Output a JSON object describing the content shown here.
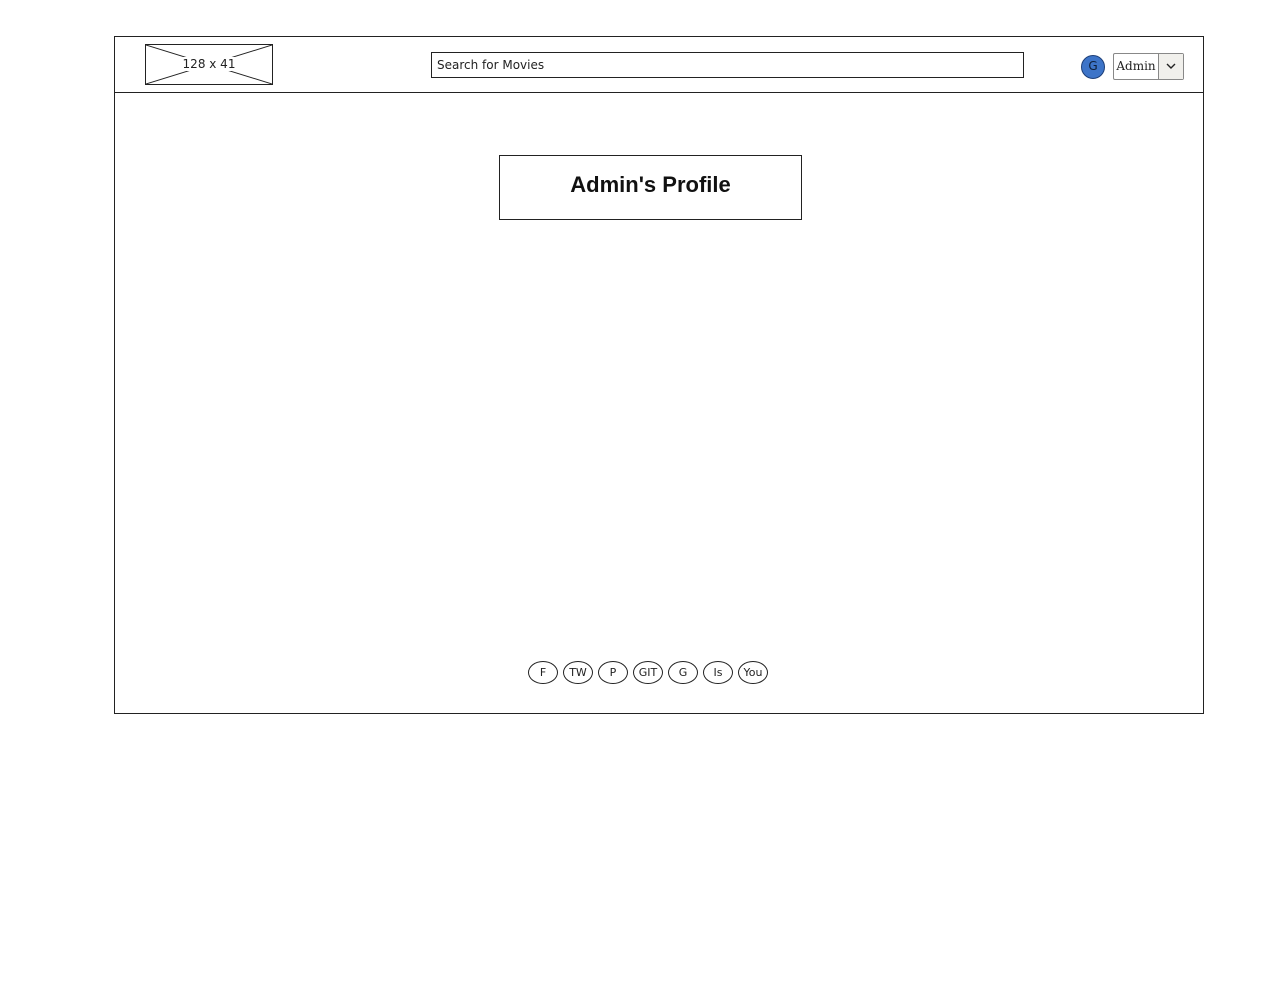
{
  "header": {
    "logo_placeholder": "128 x 41",
    "search_placeholder": "Search for Movies",
    "avatar_letter": "G",
    "user_menu_label": "Admin"
  },
  "main": {
    "title": "Admin's Profile"
  },
  "footer": {
    "social_links": [
      "F",
      "TW",
      "P",
      "GIT",
      "G",
      "Is",
      "You"
    ]
  },
  "colors": {
    "avatar_fill": "#3d74c8",
    "border": "#222222"
  },
  "icons": {
    "logo": "image-placeholder-icon",
    "dropdown": "chevron-down-icon"
  }
}
